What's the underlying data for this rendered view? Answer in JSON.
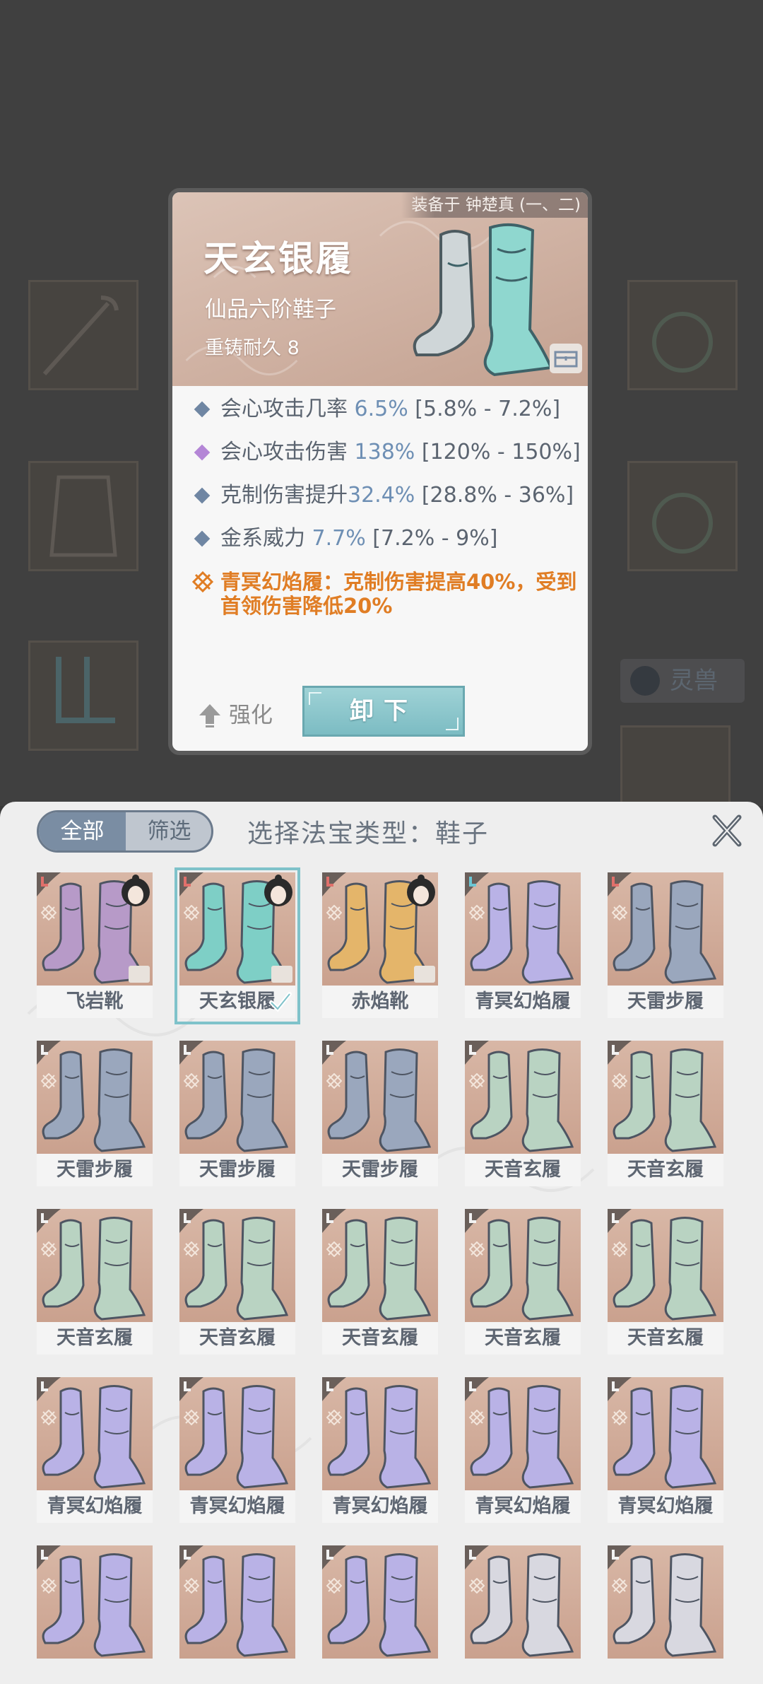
{
  "detail": {
    "equipped_on": "装备于 钟楚真 (一、二)",
    "name": "天玄银履",
    "grade": "仙品六阶鞋子",
    "recast": "重铸耐久 8",
    "stats": [
      {
        "label": "会心攻击几率 ",
        "value": "6.5%",
        "range": " [5.8% - 7.2%]",
        "color": "blue"
      },
      {
        "label": "会心攻击伤害 ",
        "value": "138%",
        "range": " [120% - 150%]",
        "color": "purple"
      },
      {
        "label": "克制伤害提升",
        "value": "32.4%",
        "range": " [28.8% - 36%]",
        "color": "blue"
      },
      {
        "label": "金系威力 ",
        "value": "7.7%",
        "range": " [7.2% - 9%]",
        "color": "blue"
      }
    ],
    "special": "青冥幻焰履：克制伤害提高40%，受到首领伤害降低20%",
    "strengthen_label": "强化",
    "unequip_label": "卸下"
  },
  "background": {
    "spirit_beast_tag": "灵兽"
  },
  "panel": {
    "tab_all": "全部",
    "tab_filter": "筛选",
    "title": "选择法宝类型：鞋子",
    "close_icon": "close-icon"
  },
  "items": [
    {
      "name": "飞岩靴",
      "tint": "violet",
      "owner": true,
      "chest": true,
      "rarity": "red"
    },
    {
      "name": "天玄银履",
      "tint": "teal",
      "owner": true,
      "chest": true,
      "rarity": "red",
      "selected": true
    },
    {
      "name": "赤焰靴",
      "tint": "gold",
      "owner": true,
      "chest": true,
      "rarity": "red"
    },
    {
      "name": "青冥幻焰履",
      "tint": "lilac",
      "rarity": "cyan"
    },
    {
      "name": "天雷步履",
      "tint": "steel",
      "rarity": "red"
    },
    {
      "name": "天雷步履",
      "tint": "steel",
      "rarity": "white"
    },
    {
      "name": "天雷步履",
      "tint": "steel",
      "rarity": "white"
    },
    {
      "name": "天雷步履",
      "tint": "steel",
      "rarity": "white"
    },
    {
      "name": "天音玄履",
      "tint": "jade",
      "rarity": "white"
    },
    {
      "name": "天音玄履",
      "tint": "jade",
      "rarity": "white"
    },
    {
      "name": "天音玄履",
      "tint": "jade",
      "rarity": "white"
    },
    {
      "name": "天音玄履",
      "tint": "jade",
      "rarity": "white"
    },
    {
      "name": "天音玄履",
      "tint": "jade",
      "rarity": "white"
    },
    {
      "name": "天音玄履",
      "tint": "jade",
      "rarity": "white"
    },
    {
      "name": "天音玄履",
      "tint": "jade",
      "rarity": "white"
    },
    {
      "name": "青冥幻焰履",
      "tint": "lilac",
      "rarity": "white"
    },
    {
      "name": "青冥幻焰履",
      "tint": "lilac",
      "rarity": "white"
    },
    {
      "name": "青冥幻焰履",
      "tint": "lilac",
      "rarity": "white"
    },
    {
      "name": "青冥幻焰履",
      "tint": "lilac",
      "rarity": "white"
    },
    {
      "name": "青冥幻焰履",
      "tint": "lilac",
      "rarity": "white"
    },
    {
      "name": "",
      "tint": "lilac",
      "rarity": "white"
    },
    {
      "name": "",
      "tint": "lilac",
      "rarity": "white"
    },
    {
      "name": "",
      "tint": "lilac",
      "rarity": "white"
    },
    {
      "name": "",
      "tint": "silver",
      "rarity": "white"
    },
    {
      "name": "",
      "tint": "silver",
      "rarity": "white"
    }
  ],
  "colors": {
    "accent_blue": "#6e8fb4",
    "special_orange": "#e07d24",
    "selected_outline": "#7fc2ca",
    "tint_violet": "#b79ac8",
    "tint_teal": "#7ecfc6",
    "tint_gold": "#e4b56a",
    "tint_lilac": "#b9b2e6",
    "tint_steel": "#9aa7bd",
    "tint_jade": "#b9d3c2",
    "tint_silver": "#d8d8e0"
  }
}
